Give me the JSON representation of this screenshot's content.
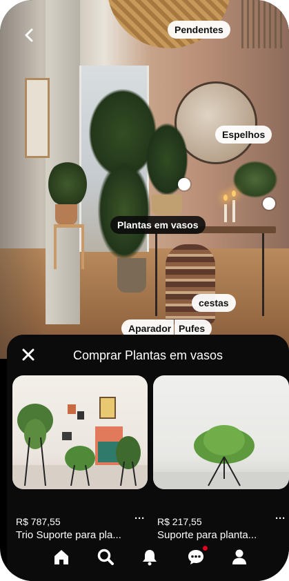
{
  "image_tags": {
    "pendentes": "Pendentes",
    "espelhos": "Espelhos",
    "plantas": "Plantas em vasos",
    "cestas": "cestas",
    "aparador": "Aparador",
    "pufes": "Pufes"
  },
  "sheet": {
    "title": "Comprar Plantas em vasos"
  },
  "products": [
    {
      "price": "R$ 787,55",
      "title": "Trio Suporte para pla..."
    },
    {
      "price": "R$ 217,55",
      "title": "Suporte para planta..."
    }
  ],
  "more_label": "···",
  "nav": {
    "items": [
      "home-icon",
      "search-icon",
      "bell-icon",
      "chat-icon",
      "profile-icon"
    ],
    "notification_color": "#e60023"
  },
  "colors": {
    "sheet_bg": "#0b0b0b",
    "tag_bg": "#ffffff"
  }
}
